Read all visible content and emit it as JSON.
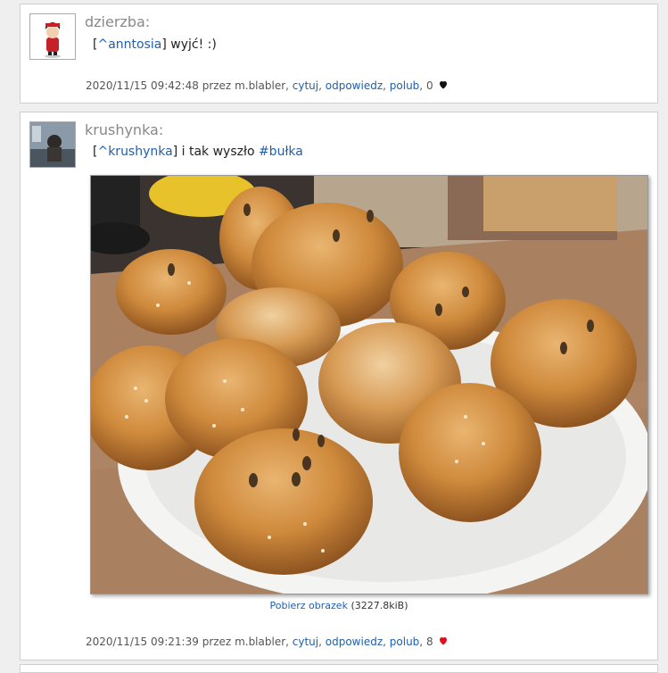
{
  "posts": [
    {
      "author": "dzierzba:",
      "body_open": "[",
      "body_mention": "^anntosia",
      "body_close": "] wyjć! :)",
      "timestamp": "2020/11/15 09:42:48",
      "by_text": "przez",
      "user": "m.blabler",
      "quote": "cytuj",
      "reply": "odpowiedz",
      "like": "polub",
      "likes_count": "0",
      "heart_color": "#111111"
    },
    {
      "author": "krushynka:",
      "body_open": "[",
      "body_mention": "^krushynka",
      "body_mid": "] i tak wyszło ",
      "body_hashtag": "#bułka",
      "download_label": "Pobierz obrazek",
      "download_size": "(3227.8kiB)",
      "timestamp": "2020/11/15 09:21:39",
      "by_text": "przez",
      "user": "m.blabler",
      "quote": "cytuj",
      "reply": "odpowiedz",
      "like": "polub",
      "likes_count": "8",
      "heart_color": "#e0101a"
    }
  ],
  "image": {
    "subject": "bread-rolls-on-white-plate"
  }
}
